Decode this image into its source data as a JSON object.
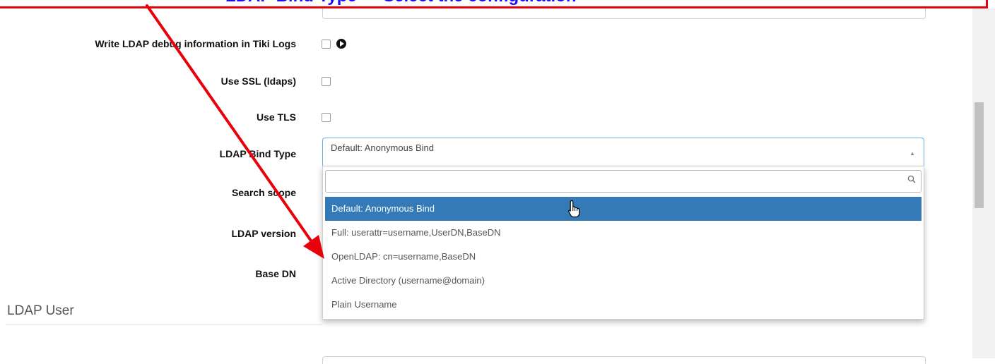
{
  "annotation": {
    "banner_text": "LDAP Bind Type — Select the configuration",
    "color": "#e8000b",
    "text_color": "#1a0dff"
  },
  "settings": {
    "debug_logs": {
      "label": "Write LDAP debug information in Tiki Logs",
      "checked": false
    },
    "use_ssl": {
      "label": "Use SSL (ldaps)",
      "checked": false
    },
    "use_tls": {
      "label": "Use TLS",
      "checked": false
    },
    "bind_type": {
      "label": "LDAP Bind Type",
      "selected": "Default: Anonymous Bind"
    },
    "search_scope": {
      "label": "Search scope"
    },
    "ldap_version": {
      "label": "LDAP version"
    },
    "base_dn": {
      "label": "Base DN"
    }
  },
  "dropdown": {
    "search_value": "",
    "highlight_color": "#337ab7",
    "options": [
      {
        "label": "Default: Anonymous Bind",
        "highlighted": true
      },
      {
        "label": "Full: userattr=username,UserDN,BaseDN",
        "highlighted": false
      },
      {
        "label": "OpenLDAP: cn=username,BaseDN",
        "highlighted": false
      },
      {
        "label": "Active Directory (username@domain)",
        "highlighted": false
      },
      {
        "label": "Plain Username",
        "highlighted": false
      }
    ]
  },
  "sections": {
    "ldap_user": "LDAP User"
  },
  "icons": {
    "info": "play-circle-icon",
    "search": "search-icon",
    "arrow": "chevron-up-icon",
    "cursor": "hand-pointer-icon"
  }
}
